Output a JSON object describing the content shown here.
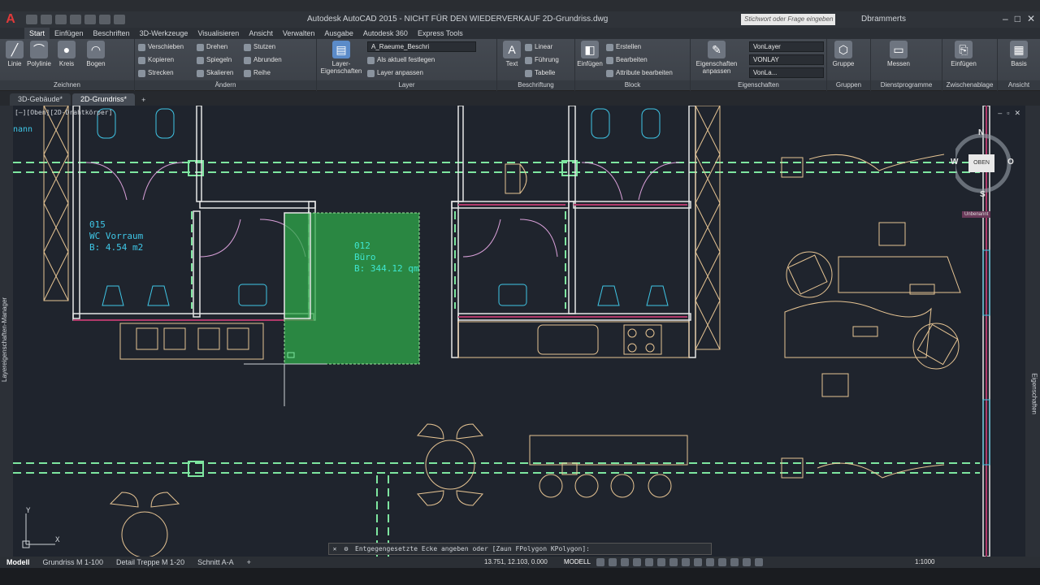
{
  "titlebar": {
    "window_title": "Autodesk AutoCAD 2015 - NICHT FÜR DEN WIEDERVERKAUF    2D-Grundriss.dwg",
    "search_placeholder": "Stichwort oder Frage eingeben",
    "user": "Dbrammerts"
  },
  "ribbon_tabs": [
    "Start",
    "Einfügen",
    "Beschriften",
    "3D-Werkzeuge",
    "Visualisieren",
    "Ansicht",
    "Verwalten",
    "Ausgabe",
    "Autodesk 360",
    "Express Tools"
  ],
  "ribbon": {
    "zeichnen": {
      "label": "Zeichnen",
      "linie": "Linie",
      "polylinie": "Polylinie",
      "kreis": "Kreis",
      "bogen": "Bogen"
    },
    "aendern": {
      "label": "Ändern",
      "verschieben": "Verschieben",
      "drehen": "Drehen",
      "stutzen": "Stutzen",
      "kopieren": "Kopieren",
      "spiegeln": "Spiegeln",
      "abrunden": "Abrunden",
      "strecken": "Strecken",
      "skalieren": "Skalieren",
      "reihe": "Reihe"
    },
    "layer": {
      "label": "Layer",
      "layer_eigenschaften": "Layer-Eigenschaften",
      "current_layer": "A_Raeume_Beschri",
      "als_aktuell": "Als aktuell festlegen",
      "layer_anpassen": "Layer anpassen"
    },
    "beschriftung": {
      "label": "Beschriftung",
      "text": "Text",
      "linear": "Linear",
      "fuehrung": "Führung",
      "tabelle": "Tabelle"
    },
    "block": {
      "label": "Block",
      "einfuegen": "Einfügen",
      "erstellen": "Erstellen",
      "bearbeiten": "Bearbeiten",
      "attribute": "Attribute bearbeiten"
    },
    "eigenschaften": {
      "label": "Eigenschaften",
      "anpassen": "Eigenschaften anpassen",
      "color": "VonLayer",
      "linetype": "VONLAY",
      "lineweight": "VonLa..."
    },
    "gruppen": {
      "label": "Gruppen",
      "gruppe": "Gruppe"
    },
    "dienstprogramme": {
      "label": "Dienstprogramme",
      "messen": "Messen"
    },
    "zwischenablage": {
      "label": "Zwischenablage",
      "einfuegen": "Einfügen"
    },
    "ansicht": {
      "label": "Ansicht",
      "basis": "Basis"
    }
  },
  "doc_tabs": [
    "3D-Gebäude*",
    "2D-Grundriss*"
  ],
  "canvas": {
    "viewport_label": "[–][Oben][2D-Drahtkörper]",
    "corner_note": "nann",
    "room_015": {
      "number": "015",
      "name": "WC Vorraum",
      "area": "B: 4.54 m2"
    },
    "room_012": {
      "number": "012",
      "name": "Büro",
      "area": "B: 344.12 qm"
    },
    "viewcube": {
      "face": "OBEN",
      "north": "N",
      "south": "S",
      "west": "W",
      "east": "O",
      "wcs": "Unbenannt"
    },
    "ucs_x": "X",
    "ucs_y": "Y"
  },
  "side_panels": {
    "left": "Layereigenschaften-Manager",
    "right": "Eigenschaften"
  },
  "command_line": {
    "prompt": "Entgegengesetzte Ecke angeben oder [Zaun FPolygon KPolygon]:"
  },
  "layout_tabs": [
    "Modell",
    "Grundriss M 1-100",
    "Detail Treppe M 1-20",
    "Schnitt A-A"
  ],
  "statusbar": {
    "coords": "13.751, 12.103, 0.000",
    "mode": "MODELL",
    "scale": "1:1000"
  },
  "colors": {
    "accent": "#3fc6e6",
    "selection": "#2fa84a",
    "wall": "#e6e6e6",
    "furniture": "#e6c493",
    "axis": "#7ee6a0"
  }
}
